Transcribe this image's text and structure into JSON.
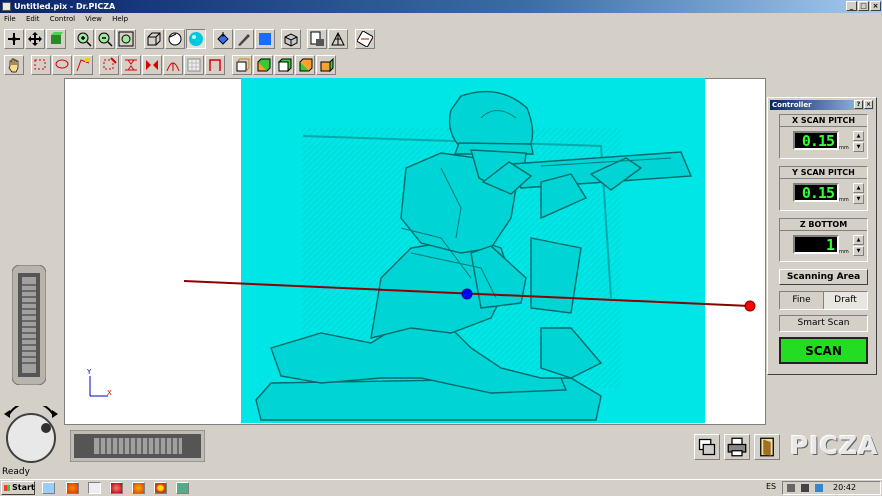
{
  "window": {
    "title": "Untitled.pix - Dr.PICZA",
    "minimize": "_",
    "maximize": "□",
    "close": "×"
  },
  "menu": [
    "File",
    "Edit",
    "Control",
    "View",
    "Help"
  ],
  "toolbar1": [
    "pan-icon",
    "move-icon",
    "fit-icon",
    "zoom-in-icon",
    "zoom-out-icon",
    "zoom-fit-icon",
    "wireframe-icon",
    "solid-icon",
    "shade-icon",
    "fill-icon",
    "pen-icon",
    "color-icon",
    "cube-icon",
    "print-preview-icon",
    "mesh-icon",
    "rotate-icon"
  ],
  "toolbar2": [
    "hand-icon",
    "rect-select-icon",
    "lasso-icon",
    "region-icon",
    "cut-icon",
    "split-icon",
    "arc-icon",
    "grid-icon",
    "frame-icon",
    "box1-icon",
    "box2-icon",
    "box3-icon",
    "box4-icon",
    "box5-icon"
  ],
  "axis": {
    "y": "Y",
    "x": "X"
  },
  "controller": {
    "title": "Controller",
    "x_pitch": {
      "label": "X SCAN PITCH",
      "value": "0.15",
      "unit": "mm"
    },
    "y_pitch": {
      "label": "Y SCAN PITCH",
      "value": "0.15",
      "unit": "mm"
    },
    "z_bottom": {
      "label": "Z BOTTOM",
      "value": "1",
      "unit": "mm"
    },
    "scanning_area": "Scanning Area",
    "fine": "Fine",
    "draft": "Draft",
    "smart_scan": "Smart Scan",
    "scan": "SCAN",
    "scan_color": "#22dd22"
  },
  "brand": "PICZA",
  "status": "Ready",
  "taskbar": {
    "start": "Start",
    "lang": "ES",
    "time": "20:42"
  },
  "colors": {
    "model": "#00e5e5",
    "probe_line": "#8b0000",
    "probe_end": "#ff0000",
    "probe_center": "#0000ff"
  }
}
